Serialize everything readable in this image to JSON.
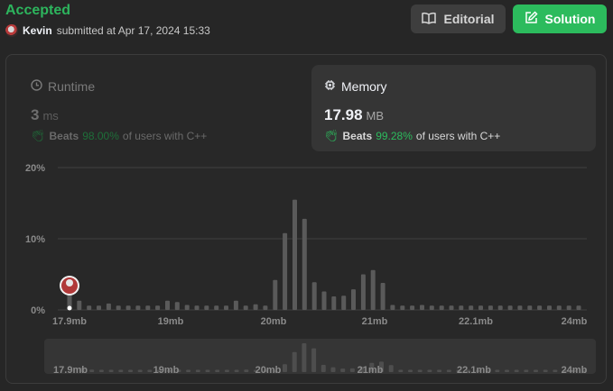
{
  "status": "Accepted",
  "submission": {
    "user": "Kevin",
    "text": "submitted at Apr 17, 2024 15:33"
  },
  "buttons": {
    "editorial": "Editorial",
    "solution": "Solution"
  },
  "runtime": {
    "title": "Runtime",
    "value": "3",
    "unit": "ms",
    "beats_label": "Beats",
    "beats_pct": "98.00%",
    "beats_suffix": "of users with C++"
  },
  "memory": {
    "title": "Memory",
    "value": "17.98",
    "unit": "MB",
    "beats_label": "Beats",
    "beats_pct": "99.28%",
    "beats_suffix": "of users with C++"
  },
  "colors": {
    "accent_green": "#2cbb5d",
    "bar": "#5a5a5a",
    "bar_mini": "#4e4e4e"
  },
  "chart_data": {
    "type": "bar",
    "title": "",
    "xlabel": "",
    "ylabel": "",
    "y_ticks": [
      "20%",
      "10%",
      "0%"
    ],
    "ylim": [
      0,
      20
    ],
    "x_ticks": [
      "17.9mb",
      "19mb",
      "20mb",
      "21mb",
      "22.1mb",
      "24mb"
    ],
    "values": [
      2.4,
      1.3,
      0.6,
      0.6,
      0.9,
      0.6,
      0.6,
      0.6,
      0.6,
      0.6,
      1.3,
      1.1,
      0.7,
      0.6,
      0.6,
      0.6,
      0.6,
      1.3,
      0.6,
      0.8,
      0.6,
      4.2,
      10.8,
      15.5,
      12.8,
      3.9,
      2.6,
      1.9,
      2.0,
      2.9,
      5.0,
      5.6,
      3.8,
      0.7,
      0.6,
      0.6,
      0.7,
      0.6,
      0.6,
      0.6,
      0.6,
      0.6,
      0.6,
      0.6,
      0.6,
      0.6,
      0.6,
      0.6,
      0.6,
      0.6,
      0.6,
      0.6,
      0.6
    ],
    "grid": true,
    "current_submission_index": 0
  }
}
